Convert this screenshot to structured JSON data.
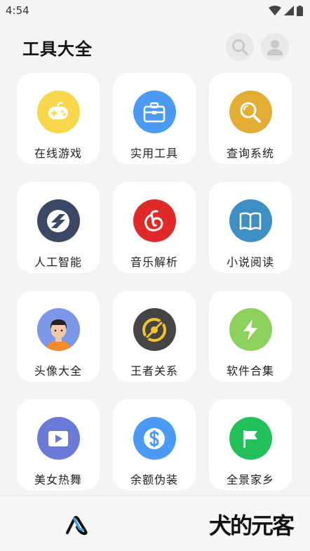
{
  "status_bar": {
    "time": "4:54"
  },
  "header": {
    "title": "工具大全"
  },
  "tools": [
    {
      "label": "在线游戏",
      "icon": "gamepad-icon",
      "color": "#F9D74B"
    },
    {
      "label": "实用工具",
      "icon": "toolbox-icon",
      "color": "#4B9BF5"
    },
    {
      "label": "查询系统",
      "icon": "magnifier-icon",
      "color": "#E3AC35"
    },
    {
      "label": "人工智能",
      "icon": "ai-logo-icon",
      "color": "#3A4866"
    },
    {
      "label": "音乐解析",
      "icon": "netease-music-icon",
      "color": "#E02A2A"
    },
    {
      "label": "小说阅读",
      "icon": "book-icon",
      "color": "#3E8FC4"
    },
    {
      "label": "头像大全",
      "icon": "avatar-icon",
      "color": "#7B97E8"
    },
    {
      "label": "王者关系",
      "icon": "game-emblem-icon",
      "color": "#444444"
    },
    {
      "label": "软件合集",
      "icon": "lightning-icon",
      "color": "#8BD15C"
    },
    {
      "label": "美女热舞",
      "icon": "video-play-icon",
      "color": "#6B7AD6"
    },
    {
      "label": "余额伪装",
      "icon": "dollar-icon",
      "color": "#4B9BF5"
    },
    {
      "label": "全景家乡",
      "icon": "flag-icon",
      "color": "#22C05A"
    }
  ],
  "bottom_nav": {
    "home_icon": "app-logo-icon"
  },
  "watermark": {
    "text": "犬的元客"
  }
}
